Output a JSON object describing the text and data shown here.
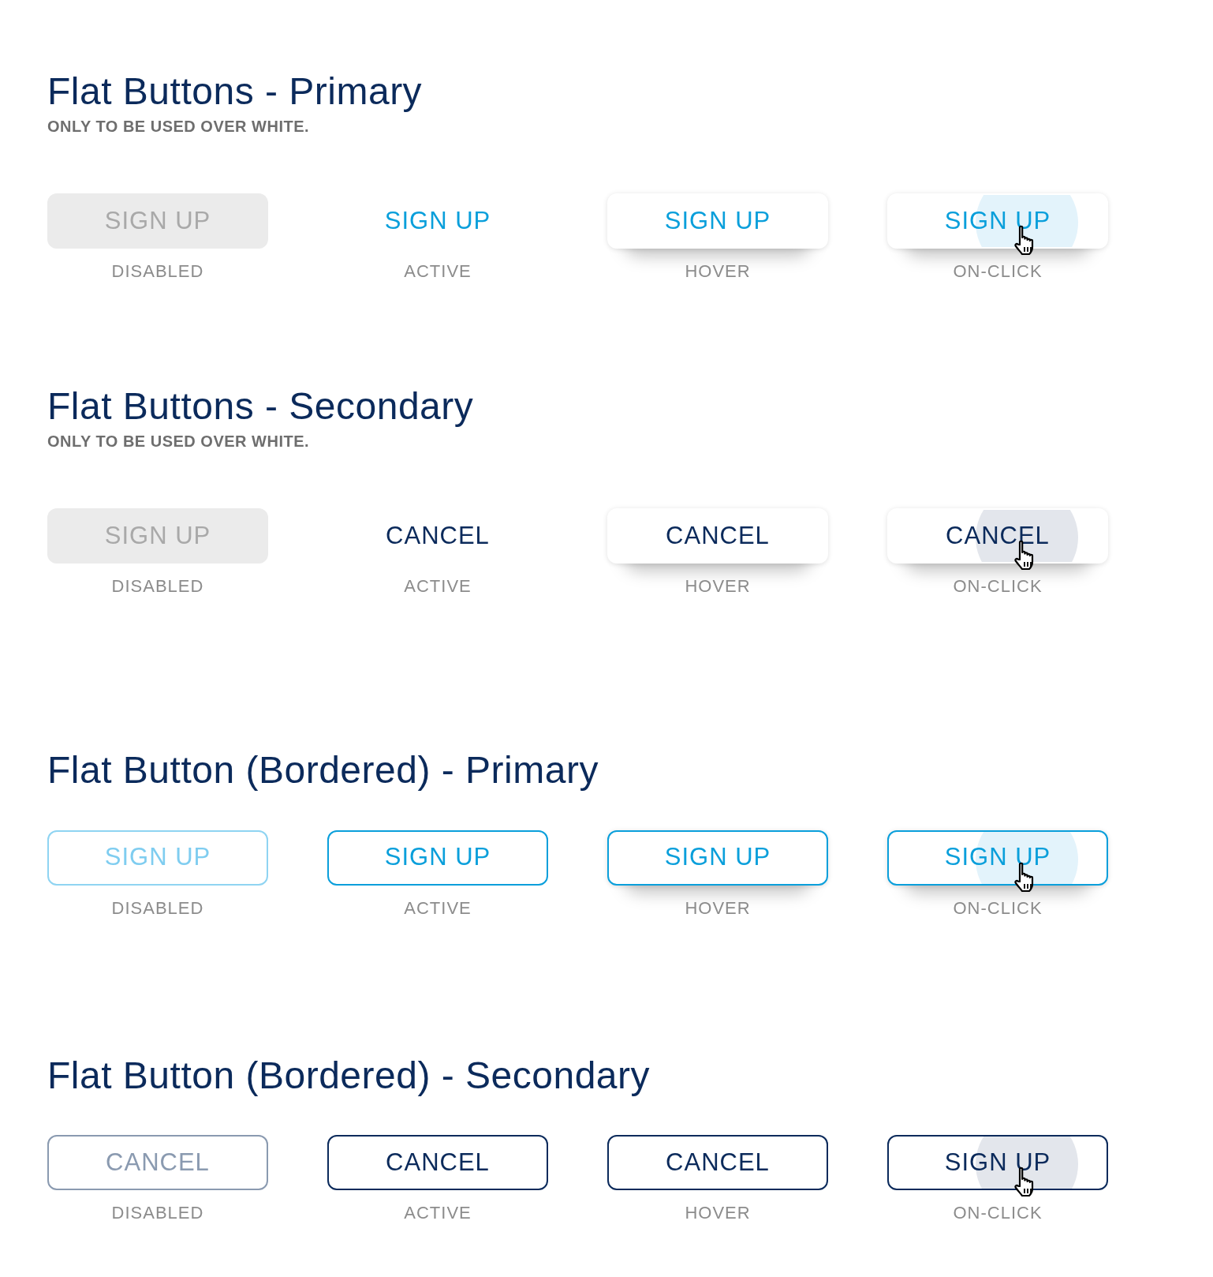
{
  "sections": [
    {
      "title": "Flat Buttons - Primary",
      "subtitle": "ONLY TO BE USED OVER WHITE.",
      "kind": "primary",
      "bordered": false,
      "buttons": [
        {
          "label": "SIGN UP",
          "caption": "DISABLED",
          "disabled": true,
          "raised": false,
          "pressed": false
        },
        {
          "label": "SIGN UP",
          "caption": "ACTIVE",
          "disabled": false,
          "raised": false,
          "pressed": false
        },
        {
          "label": "SIGN UP",
          "caption": "HOVER",
          "disabled": false,
          "raised": true,
          "pressed": false
        },
        {
          "label": "SIGN UP",
          "caption": "ON-CLICK",
          "disabled": false,
          "raised": true,
          "pressed": true
        }
      ]
    },
    {
      "title": "Flat Buttons - Secondary",
      "subtitle": "ONLY TO BE USED OVER WHITE.",
      "kind": "secondary",
      "bordered": false,
      "buttons": [
        {
          "label": "SIGN UP",
          "caption": "DISABLED",
          "disabled": true,
          "raised": false,
          "pressed": false
        },
        {
          "label": "CANCEL",
          "caption": "ACTIVE",
          "disabled": false,
          "raised": false,
          "pressed": false
        },
        {
          "label": "CANCEL",
          "caption": "HOVER",
          "disabled": false,
          "raised": true,
          "pressed": false
        },
        {
          "label": "CANCEL",
          "caption": "ON-CLICK",
          "disabled": false,
          "raised": true,
          "pressed": true
        }
      ]
    },
    {
      "title": "Flat Button (Bordered) - Primary",
      "kind": "primary",
      "bordered": true,
      "buttons": [
        {
          "label": "SIGN UP",
          "caption": "DISABLED",
          "disabled": true,
          "raised": false,
          "pressed": false
        },
        {
          "label": "SIGN UP",
          "caption": "ACTIVE",
          "disabled": false,
          "raised": false,
          "pressed": false
        },
        {
          "label": "SIGN UP",
          "caption": "HOVER",
          "disabled": false,
          "raised": true,
          "pressed": false
        },
        {
          "label": "SIGN UP",
          "caption": "ON-CLICK",
          "disabled": false,
          "raised": true,
          "pressed": true
        }
      ]
    },
    {
      "title": "Flat Button (Bordered) - Secondary",
      "kind": "secondary",
      "bordered": true,
      "buttons": [
        {
          "label": "CANCEL",
          "caption": "DISABLED",
          "disabled": true,
          "raised": false,
          "pressed": false
        },
        {
          "label": "CANCEL",
          "caption": "ACTIVE",
          "disabled": false,
          "raised": false,
          "pressed": false
        },
        {
          "label": "CANCEL",
          "caption": "HOVER",
          "disabled": false,
          "raised": false,
          "pressed": false
        },
        {
          "label": "SIGN UP",
          "caption": "ON-CLICK",
          "disabled": false,
          "raised": false,
          "pressed": true
        }
      ]
    }
  ]
}
